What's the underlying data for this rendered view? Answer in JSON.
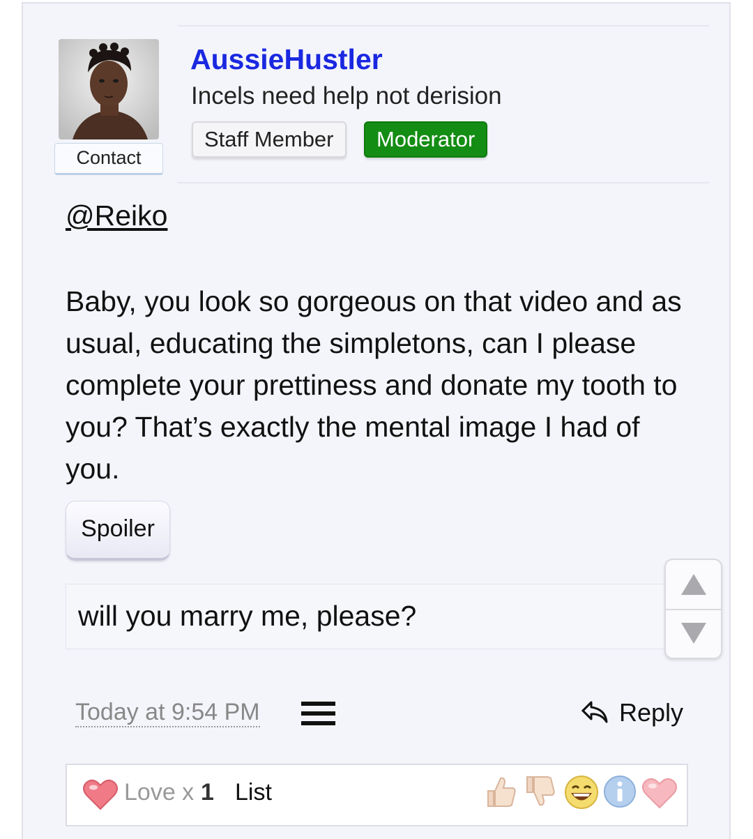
{
  "post": {
    "author": {
      "username": "AussieHustler",
      "user_title": "Incels need help not derision",
      "contact_label": "Contact",
      "badges": [
        "Staff Member",
        "Moderator"
      ]
    },
    "mention": "@Reiko",
    "body": "Baby, you look so gorgeous on that video and as usual, educating the simpletons, can I please complete your prettiness and donate my tooth to you? That’s exactly the mental image I had of you.",
    "spoiler": {
      "button_label": "Spoiler",
      "content": "will you marry me, please?"
    },
    "timestamp": "Today at 9:54 PM",
    "reply_label": "Reply",
    "reactions": {
      "love_label": "Love x",
      "love_count": "1",
      "list_label": "List"
    }
  },
  "colors": {
    "username": "#1a28e0",
    "moderator_badge": "#148d14",
    "card_background": "#f4f5fb"
  },
  "icons": [
    "menu-icon",
    "reply-arrow-icon",
    "heart-icon",
    "thumbs-up-icon",
    "thumbs-down-icon",
    "laugh-icon",
    "info-icon",
    "love-icon"
  ]
}
